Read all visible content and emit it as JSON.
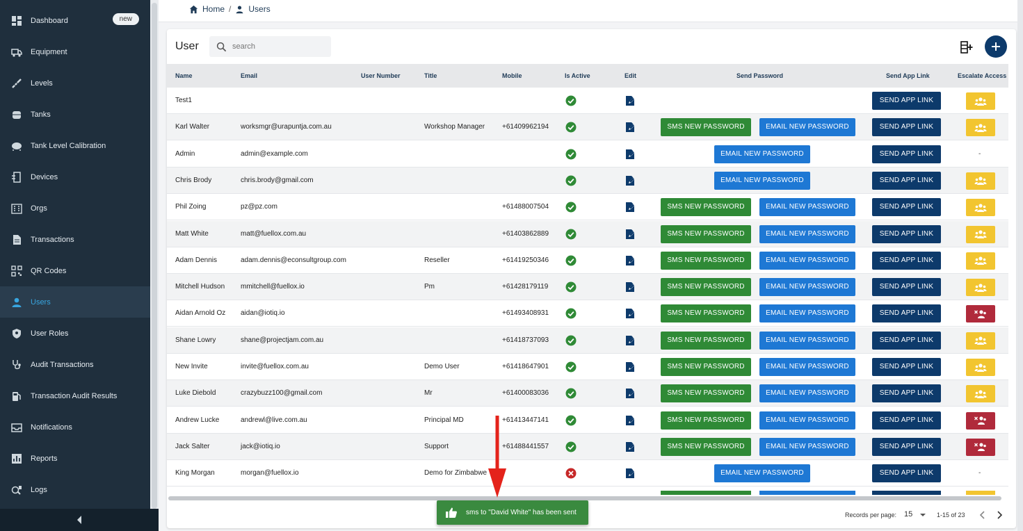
{
  "sidebar": {
    "items": [
      {
        "label": "Dashboard",
        "icon": "dashboard-icon",
        "badge": "new"
      },
      {
        "label": "Equipment",
        "icon": "truck-icon"
      },
      {
        "label": "Levels",
        "icon": "dipstick-icon"
      },
      {
        "label": "Tanks",
        "icon": "tank-icon"
      },
      {
        "label": "Tank Level Calibration",
        "icon": "calibration-icon"
      },
      {
        "label": "Devices",
        "icon": "device-icon"
      },
      {
        "label": "Orgs",
        "icon": "building-icon"
      },
      {
        "label": "Transactions",
        "icon": "document-icon"
      },
      {
        "label": "QR Codes",
        "icon": "qr-code-icon"
      },
      {
        "label": "Users",
        "icon": "user-icon",
        "active": true
      },
      {
        "label": "User Roles",
        "icon": "shield-icon"
      },
      {
        "label": "Audit Transactions",
        "icon": "stethoscope-icon"
      },
      {
        "label": "Transaction Audit Results",
        "icon": "fuel-icon"
      },
      {
        "label": "Notifications",
        "icon": "inbox-icon"
      },
      {
        "label": "Reports",
        "icon": "chart-icon"
      },
      {
        "label": "Logs",
        "icon": "log-icon"
      }
    ]
  },
  "breadcrumb": {
    "home": "Home",
    "separator": "/",
    "current": "Users"
  },
  "card": {
    "title": "User",
    "search_placeholder": "search"
  },
  "columns": {
    "name": "Name",
    "email": "Email",
    "user_number": "User Number",
    "title": "Title",
    "mobile": "Mobile",
    "is_active": "Is Active",
    "edit": "Edit",
    "send_password": "Send Password",
    "send_app_link": "Send App Link",
    "escalate": "Escalate Access"
  },
  "buttons": {
    "sms": "SMS NEW PASSWORD",
    "email": "EMAIL NEW PASSWORD",
    "app": "SEND APP LINK"
  },
  "rows": [
    {
      "name": "Test1",
      "email": "",
      "title": "",
      "mobile": "",
      "active": true,
      "sms": false,
      "email_btn": false,
      "escalate": "yellow"
    },
    {
      "name": "Karl Walter",
      "email": "worksmgr@urapuntja.com.au",
      "title": "Workshop Manager",
      "mobile": "+61409962194",
      "active": true,
      "sms": true,
      "email_btn": true,
      "escalate": "yellow"
    },
    {
      "name": "Admin",
      "email": "admin@example.com",
      "title": "",
      "mobile": "",
      "active": true,
      "sms": false,
      "email_btn": true,
      "escalate": "none"
    },
    {
      "name": "Chris Brody",
      "email": "chris.brody@gmail.com",
      "title": "",
      "mobile": "",
      "active": true,
      "sms": false,
      "email_btn": true,
      "escalate": "yellow"
    },
    {
      "name": "Phil Zoing",
      "email": "pz@pz.com",
      "title": "",
      "mobile": "+61488007504",
      "active": true,
      "sms": true,
      "email_btn": true,
      "escalate": "yellow"
    },
    {
      "name": "Matt White",
      "email": "matt@fuellox.com.au",
      "title": "",
      "mobile": "+61403862889",
      "active": true,
      "sms": true,
      "email_btn": true,
      "escalate": "yellow"
    },
    {
      "name": "Adam Dennis",
      "email": "adam.dennis@econsultgroup.com",
      "title": "Reseller",
      "mobile": "+61419250346",
      "active": true,
      "sms": true,
      "email_btn": true,
      "escalate": "yellow"
    },
    {
      "name": "Mitchell Hudson",
      "email": "mmitchell@fuellox.io",
      "title": "Pm",
      "mobile": "+61428179119",
      "active": true,
      "sms": true,
      "email_btn": true,
      "escalate": "yellow"
    },
    {
      "name": "Aidan Arnold Oz",
      "email": "aidan@iotiq.io",
      "title": "",
      "mobile": "+61493408931",
      "active": true,
      "sms": true,
      "email_btn": true,
      "escalate": "red"
    },
    {
      "name": "Shane Lowry",
      "email": "shane@projectjam.com.au",
      "title": "",
      "mobile": "+61418737093",
      "active": true,
      "sms": true,
      "email_btn": true,
      "escalate": "yellow"
    },
    {
      "name": "New Invite",
      "email": "invite@fuellox.com.au",
      "title": "Demo User",
      "mobile": "+61418647901",
      "active": true,
      "sms": true,
      "email_btn": true,
      "escalate": "yellow"
    },
    {
      "name": "Luke Diebold",
      "email": "crazybuzz100@gmail.com",
      "title": "Mr",
      "mobile": "+61400083036",
      "active": true,
      "sms": true,
      "email_btn": true,
      "escalate": "yellow"
    },
    {
      "name": "Andrew Lucke",
      "email": "andrewl@live.com.au",
      "title": "Principal MD",
      "mobile": "+61413447141",
      "active": true,
      "sms": true,
      "email_btn": true,
      "escalate": "red"
    },
    {
      "name": "Jack Salter",
      "email": "jack@iotiq.io",
      "title": "Support",
      "mobile": "+61488441557",
      "active": true,
      "sms": true,
      "email_btn": true,
      "escalate": "red"
    },
    {
      "name": "King Morgan",
      "email": "morgan@fuellox.io",
      "title": "Demo for Zimbabwe",
      "mobile": "",
      "active": false,
      "sms": false,
      "email_btn": true,
      "escalate": "none"
    }
  ],
  "escalate_dash": "-",
  "footer": {
    "records_per_page_label": "Records per page:",
    "records_per_page": "15",
    "range": "1-15 of 23"
  },
  "toast": {
    "message": "sms to \"David White\" has been sent"
  },
  "colors": {
    "sms": "#2f8a36",
    "email": "#1e78d4",
    "app": "#0d3a6b",
    "escalate_yellow": "#f2c530",
    "escalate_red": "#b02a3b",
    "sidebar": "#1f2f3d",
    "active": "#38a6e0",
    "toast": "#3a8a3f"
  }
}
